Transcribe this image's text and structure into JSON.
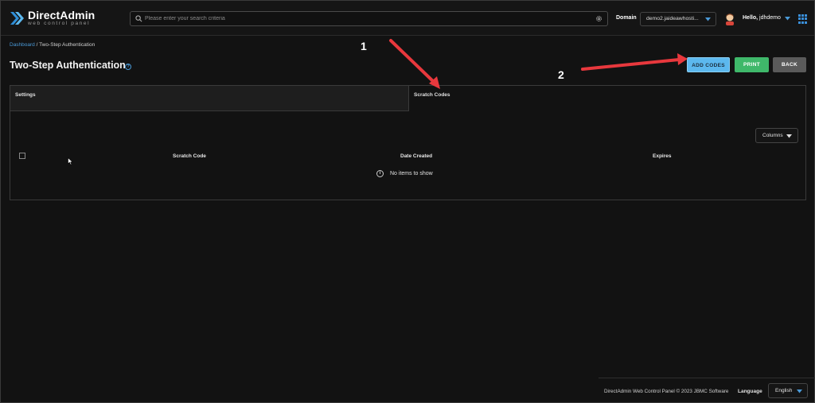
{
  "header": {
    "logo_title": "DirectAdmin",
    "logo_subtitle": "web control panel",
    "search_placeholder": "Please enter your search criteria",
    "domain_label": "Domain",
    "domain_value": "demo2.jaideawhosti...",
    "greeting": "Hello,",
    "username": "jdhdemo"
  },
  "breadcrumb": {
    "home": "Dashboard",
    "separator": " / ",
    "current": "Two-Step Authentication"
  },
  "page": {
    "title": "Two-Step Authentication",
    "help_glyph": "?"
  },
  "actions": {
    "add_codes": "ADD CODES",
    "print": "PRINT",
    "back": "BACK"
  },
  "tabs": [
    {
      "label": "Settings",
      "active": false
    },
    {
      "label": "Scratch Codes",
      "active": true
    }
  ],
  "table": {
    "columns_button": "Columns",
    "headers": [
      "Scratch Code",
      "Date Created",
      "Expires"
    ],
    "empty_message": "No items to show",
    "info_glyph": "i"
  },
  "annotations": {
    "marker_1": "1",
    "marker_2": "2",
    "arrow_color": "#e8383d"
  },
  "footer": {
    "copyright": "DirectAdmin Web Control Panel © 2023 JBMC Software",
    "language_label": "Language",
    "language_value": "English"
  },
  "colors": {
    "accent_blue": "#4a9ad8",
    "add_button": "#5cb8ee",
    "print_button": "#3fb86a",
    "back_button": "#5a5a5a",
    "background": "#121212"
  },
  "icons": {
    "logo": "directadmin-chevron-icon",
    "search": "search-icon",
    "settings": "gear-icon",
    "avatar": "user-avatar-icon",
    "apps": "grid-icon"
  }
}
